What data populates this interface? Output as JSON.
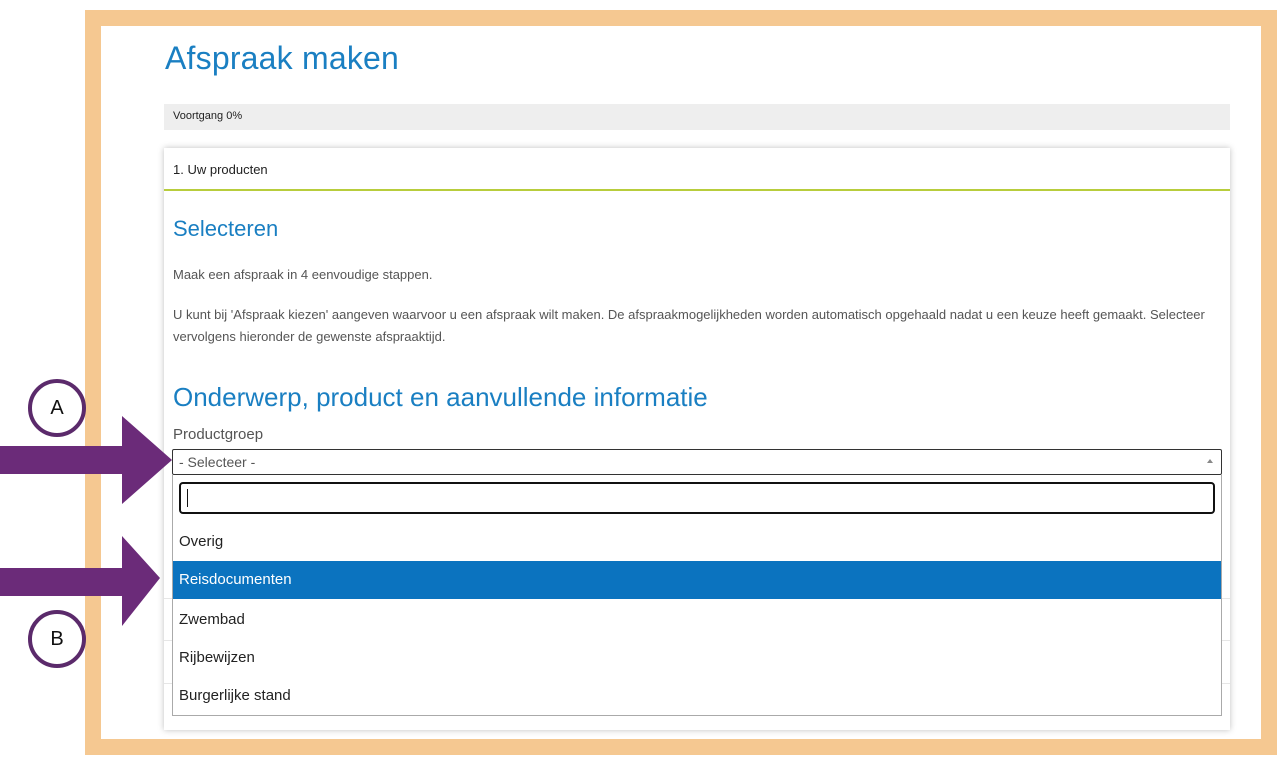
{
  "page": {
    "title": "Afspraak maken",
    "progress_label": "Voortgang 0%",
    "progress_value": 0
  },
  "card": {
    "header": "1. Uw producten",
    "section1_title": "Selecteren",
    "para1": "Maak een afspraak in 4 eenvoudige stappen.",
    "para2": "U kunt bij 'Afspraak kiezen' aangeven waarvoor u een afspraak wilt maken. De afspraakmogelijkheden worden automatisch opgehaald nadat u een keuze heeft gemaakt. Selecteer vervolgens hieronder de gewenste afspraaktijd.",
    "section2_title": "Onderwerp, product en aanvullende informatie",
    "field_label": "Productgroep"
  },
  "select": {
    "value": "- Selecteer -",
    "search_value": "",
    "options": [
      "Overig",
      "Reisdocumenten",
      "Zwembad",
      "Rijbewijzen",
      "Burgerlijke stand"
    ],
    "highlighted": "Reisdocumenten"
  },
  "annotations": {
    "marker_a": "A",
    "marker_b": "B",
    "arrow_color": "#6b2b79",
    "circle_border_color": "#5b2a6b"
  },
  "colors": {
    "frame": "#f5c891",
    "heading": "#1a7fc2",
    "highlight": "#0b73bf",
    "header_underline": "#b8cd3c"
  }
}
